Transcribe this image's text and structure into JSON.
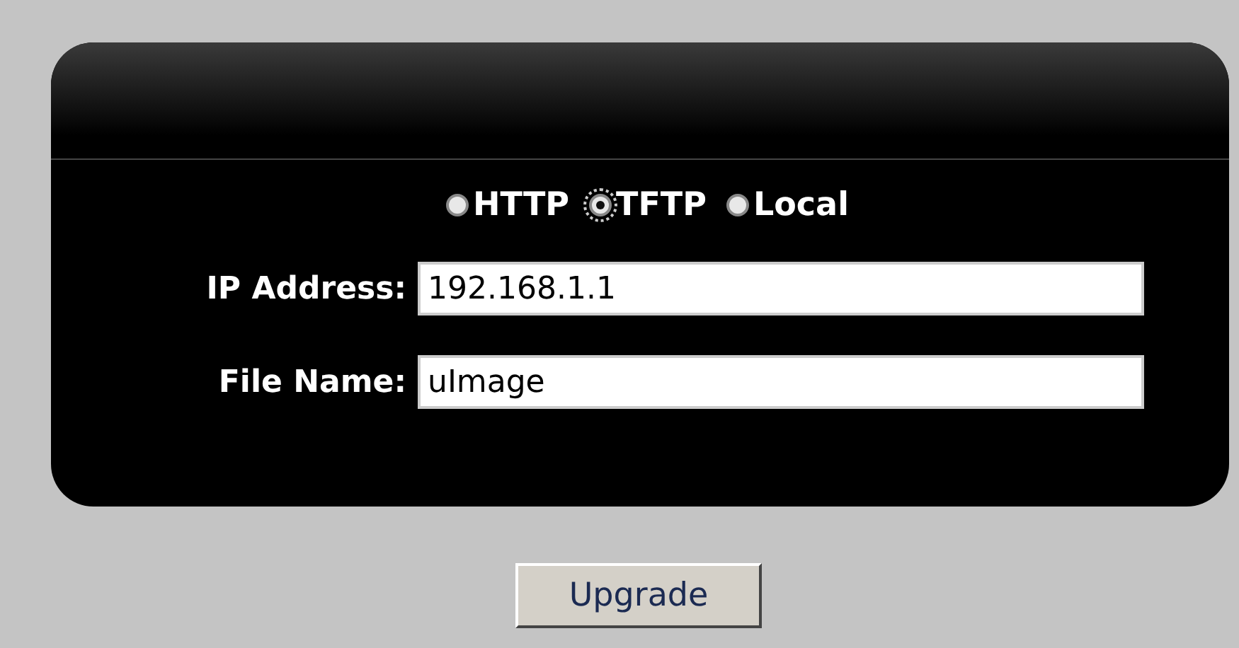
{
  "protocols": [
    {
      "label": "HTTP",
      "selected": false
    },
    {
      "label": "TFTP",
      "selected": true
    },
    {
      "label": "Local",
      "selected": false
    }
  ],
  "fields": [
    {
      "label": "IP Address:",
      "value": "192.168.1.1"
    },
    {
      "label": "File Name:",
      "value": "uImage"
    }
  ],
  "button": "Upgrade"
}
